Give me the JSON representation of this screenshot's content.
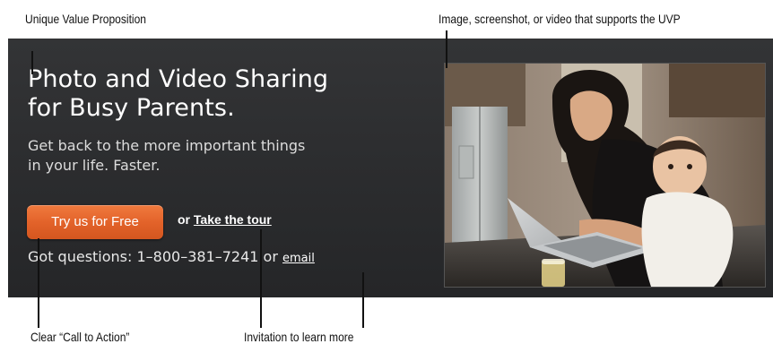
{
  "annotations": {
    "uvp": "Unique Value Proposition",
    "media": "Image, screenshot, or video that supports the UVP",
    "cta": "Clear  “Call to Action”",
    "learn": "Invitation to learn more"
  },
  "hero": {
    "headline_line1": "Photo and Video Sharing",
    "headline_line2": "for Busy Parents.",
    "subhead_line1": "Get back to the more important things",
    "subhead_line2": "in your life. Faster.",
    "cta_label": "Try us for Free",
    "or_text": "or",
    "tour_label": "Take the tour",
    "questions_text": "Got questions: 1–800–381–7241 or",
    "email_label": "email"
  },
  "photo": {
    "icon": "mother-and-baby-at-laptop-photo"
  },
  "colors": {
    "panel_bg": "#2e2f31",
    "cta_orange": "#e3632a",
    "text_white": "#ffffff"
  }
}
